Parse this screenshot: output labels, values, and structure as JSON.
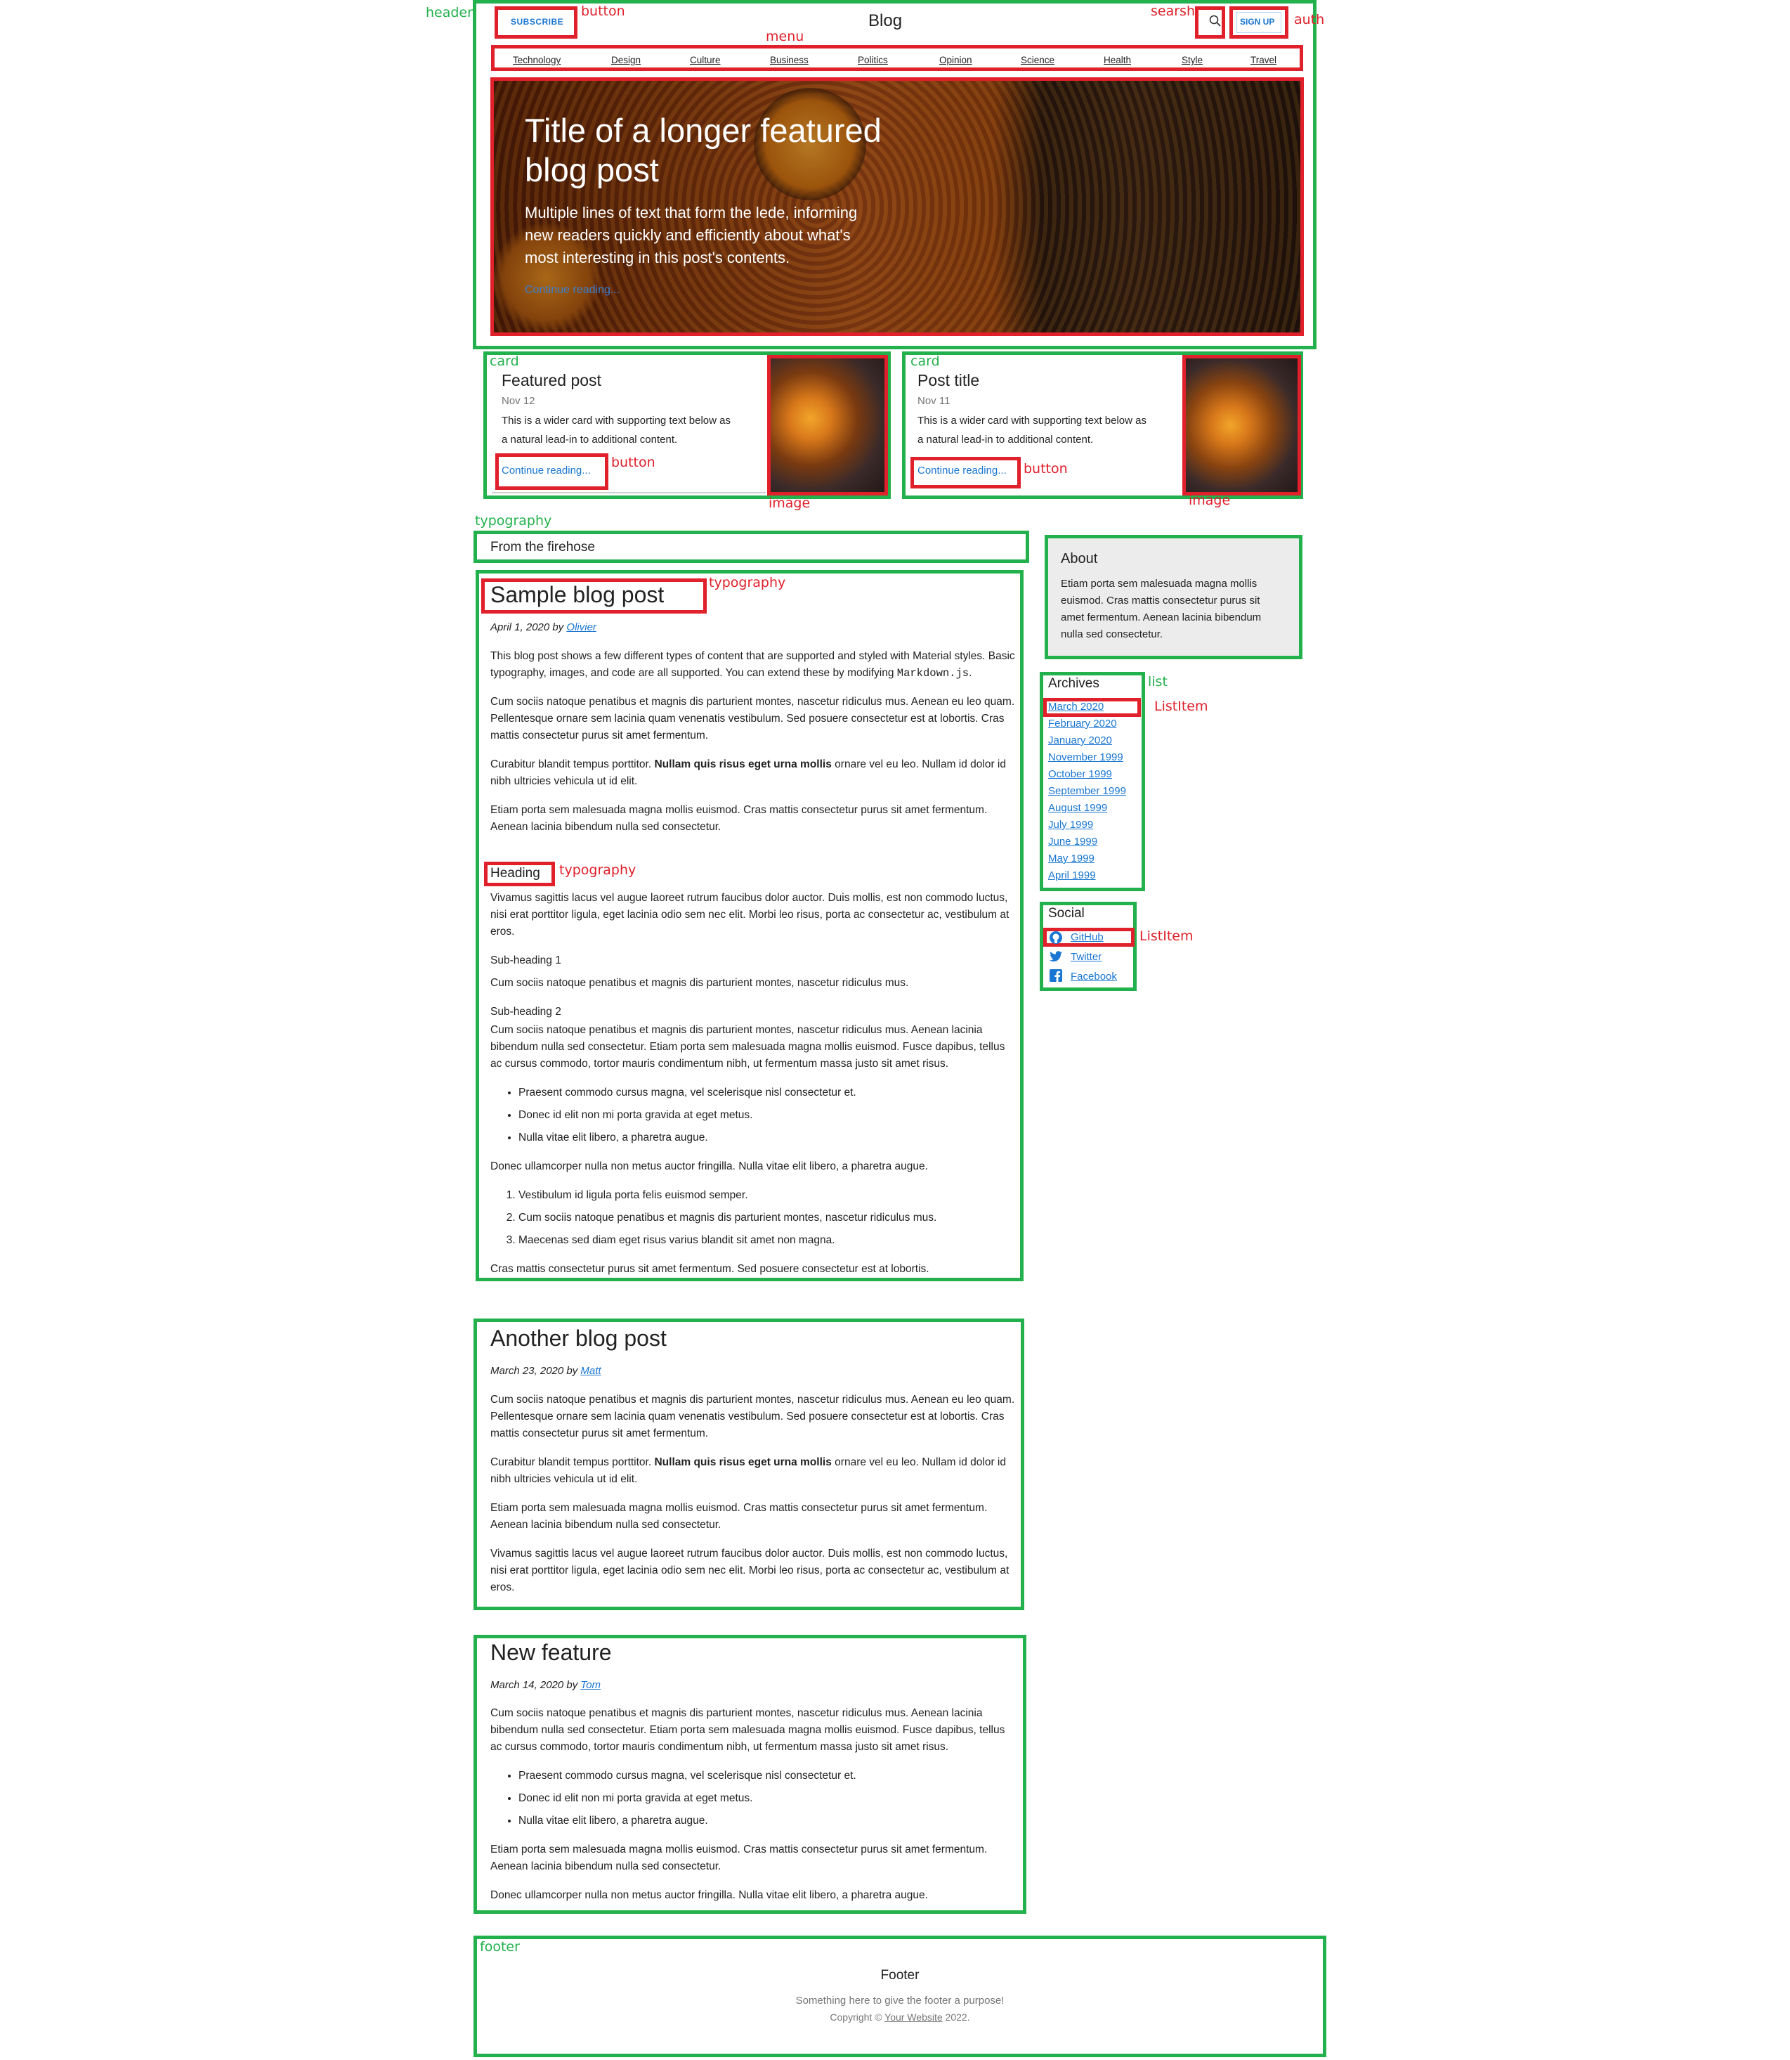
{
  "annotations": {
    "header": "header",
    "button": "button",
    "menu": "menu",
    "search": "searsh",
    "auth": "auth",
    "card": "card",
    "image": "image",
    "typography": "typography",
    "sidemenu": "sidemenu",
    "list": "list",
    "listitem": "ListItem",
    "footer": "footer"
  },
  "header": {
    "subscribe_label": "SUBSCRIBE",
    "title": "Blog",
    "signup_label": "SIGN UP"
  },
  "menu": [
    "Technology",
    "Design",
    "Culture",
    "Business",
    "Politics",
    "Opinion",
    "Science",
    "Health",
    "Style",
    "Travel"
  ],
  "hero": {
    "title_line1": "Title of a longer featured",
    "title_line2": "blog post",
    "lede_line1": "Multiple lines of text that form the lede, informing",
    "lede_line2": "new readers quickly and efficiently about what's",
    "lede_line3": "most interesting in this post's contents.",
    "link": "Continue reading..."
  },
  "cards": [
    {
      "title": "Featured post",
      "date": "Nov 12",
      "text_line1": "This is a wider card with supporting text below as",
      "text_line2": "a natural lead-in to additional content.",
      "link": "Continue reading..."
    },
    {
      "title": "Post title",
      "date": "Nov 11",
      "text_line1": "This is a wider card with supporting text below as",
      "text_line2": "a natural lead-in to additional content.",
      "link": "Continue reading..."
    }
  ],
  "firehose_label": "From the firehose",
  "post1": {
    "title": "Sample blog post",
    "date": "April 1, 2020 by ",
    "author": "Olivier",
    "intro_a": "This blog post shows a few different types of content that are supported and styled with Material styles. Basic typography, images, and code are all supported. You can extend these by modifying ",
    "intro_code": "Markdown.js",
    "intro_b": ".",
    "p1": "Cum sociis natoque penatibus et magnis dis parturient montes, nascetur ridiculus mus. Aenean eu leo quam. Pellentesque ornare sem lacinia quam venenatis vestibulum. Sed posuere consectetur est at lobortis. Cras mattis consectetur purus sit amet fermentum.",
    "p2a": "Curabitur blandit tempus porttitor. ",
    "p2b": "Nullam quis risus eget urna mollis",
    "p2c": " ornare vel eu leo. Nullam id dolor id nibh ultricies vehicula ut id elit.",
    "p3": "Etiam porta sem malesuada magna mollis euismod. Cras mattis consectetur purus sit amet fermentum. Aenean lacinia bibendum nulla sed consectetur.",
    "heading": "Heading",
    "p4": "Vivamus sagittis lacus vel augue laoreet rutrum faucibus dolor auctor. Duis mollis, est non commodo luctus, nisi erat porttitor ligula, eget lacinia odio sem nec elit. Morbi leo risus, porta ac consectetur ac, vestibulum at eros.",
    "sub1": "Sub-heading 1",
    "p5": "Cum sociis natoque penatibus et magnis dis parturient montes, nascetur ridiculus mus.",
    "sub2": "Sub-heading 2",
    "p6": "Cum sociis natoque penatibus et magnis dis parturient montes, nascetur ridiculus mus. Aenean lacinia bibendum nulla sed consectetur. Etiam porta sem malesuada magna mollis euismod. Fusce dapibus, tellus ac cursus commodo, tortor mauris condimentum nibh, ut fermentum massa justo sit amet risus.",
    "bullets": [
      "Praesent commodo cursus magna, vel scelerisque nisl consectetur et.",
      "Donec id elit non mi porta gravida at eget metus.",
      "Nulla vitae elit libero, a pharetra augue."
    ],
    "p7": "Donec ullamcorper nulla non metus auctor fringilla. Nulla vitae elit libero, a pharetra augue.",
    "numbered": [
      "Vestibulum id ligula porta felis euismod semper.",
      "Cum sociis natoque penatibus et magnis dis parturient montes, nascetur ridiculus mus.",
      "Maecenas sed diam eget risus varius blandit sit amet non magna."
    ],
    "p8": "Cras mattis consectetur purus sit amet fermentum. Sed posuere consectetur est at lobortis."
  },
  "post2": {
    "title": "Another blog post",
    "date": "March 23, 2020 by ",
    "author": "Matt",
    "p1": "Cum sociis natoque penatibus et magnis dis parturient montes, nascetur ridiculus mus. Aenean eu leo quam. Pellentesque ornare sem lacinia quam venenatis vestibulum. Sed posuere consectetur est at lobortis. Cras mattis consectetur purus sit amet fermentum.",
    "p2a": "Curabitur blandit tempus porttitor. ",
    "p2b": "Nullam quis risus eget urna mollis",
    "p2c": " ornare vel eu leo. Nullam id dolor id nibh ultricies vehicula ut id elit.",
    "p3": "Etiam porta sem malesuada magna mollis euismod. Cras mattis consectetur purus sit amet fermentum. Aenean lacinia bibendum nulla sed consectetur.",
    "p4": "Vivamus sagittis lacus vel augue laoreet rutrum faucibus dolor auctor. Duis mollis, est non commodo luctus, nisi erat porttitor ligula, eget lacinia odio sem nec elit. Morbi leo risus, porta ac consectetur ac, vestibulum at eros."
  },
  "post3": {
    "title": "New feature",
    "date": "March 14, 2020 by ",
    "author": "Tom",
    "p1": "Cum sociis natoque penatibus et magnis dis parturient montes, nascetur ridiculus mus. Aenean lacinia bibendum nulla sed consectetur. Etiam porta sem malesuada magna mollis euismod. Fusce dapibus, tellus ac cursus commodo, tortor mauris condimentum nibh, ut fermentum massa justo sit amet risus.",
    "bullets": [
      "Praesent commodo cursus magna, vel scelerisque nisl consectetur et.",
      "Donec id elit non mi porta gravida at eget metus.",
      "Nulla vitae elit libero, a pharetra augue."
    ],
    "p2": "Etiam porta sem malesuada magna mollis euismod. Cras mattis consectetur purus sit amet fermentum. Aenean lacinia bibendum nulla sed consectetur.",
    "p3": "Donec ullamcorper nulla non metus auctor fringilla. Nulla vitae elit libero, a pharetra augue."
  },
  "about": {
    "title": "About",
    "line1": "Etiam porta sem malesuada magna mollis",
    "line2": "euismod. Cras mattis consectetur purus sit",
    "line3": "amet fermentum. Aenean lacinia bibendum",
    "line4": "nulla sed consectetur."
  },
  "archives": {
    "title": "Archives",
    "items": [
      "March 2020",
      "February 2020",
      "January 2020",
      "November 1999",
      "October 1999",
      "September 1999",
      "August 1999",
      "July 1999",
      "June 1999",
      "May 1999",
      "April 1999"
    ]
  },
  "social": {
    "title": "Social",
    "items": [
      {
        "label": "GitHub",
        "icon": "github-icon"
      },
      {
        "label": "Twitter",
        "icon": "twitter-icon"
      },
      {
        "label": "Facebook",
        "icon": "facebook-icon"
      }
    ]
  },
  "footer": {
    "title": "Footer",
    "tagline": "Something here to give the footer a purpose!",
    "copyright_prefix": "Copyright © ",
    "site_link": "Your Website",
    "year": " 2022."
  },
  "colors": {
    "annotation_green": "#22b14c",
    "annotation_red": "#e0202a",
    "link_blue": "#1976d2"
  }
}
